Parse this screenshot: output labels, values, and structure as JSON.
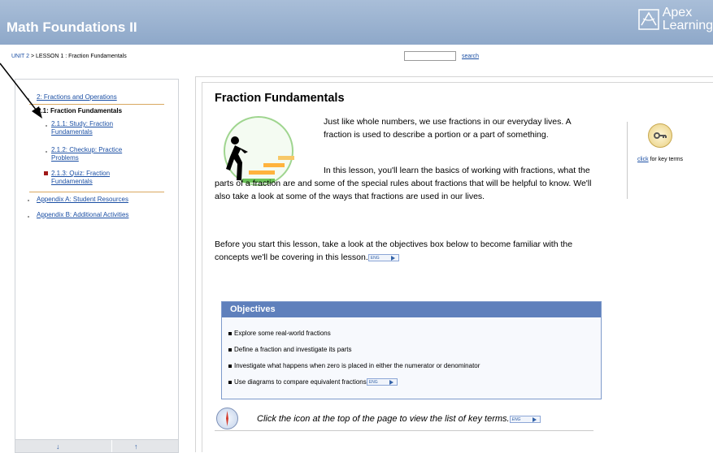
{
  "header": {
    "title": "Math Foundations II",
    "logo_lines": [
      "Apex",
      "Learning"
    ]
  },
  "breadcrumb": {
    "unit": "UNIT 2",
    "sep": " > ",
    "lesson": "LESSON 1 : Fraction Fundamentals"
  },
  "search": {
    "label": "search",
    "value": ""
  },
  "toc": {
    "items": [
      "2: Fractions and Operations",
      "2.1: Fraction Fundamentals",
      "2.1.1: Study: Fraction Fundamentals",
      "2.1.2: Checkup: Practice Problems",
      "2.1.3: Quiz: Fraction Fundamentals",
      "Appendix A: Student Resources",
      "Appendix B: Additional Activities"
    ]
  },
  "content": {
    "title": "Fraction Fundamentals",
    "p1": "Just like whole numbers, we use fractions in our everyday lives. A fraction is used to describe a portion or a part of something.",
    "p2": "In this lesson, you'll learn the basics of working with fractions, what the parts of a fraction are and some of the special rules about fractions that will be helpful to know. We'll also take a look at some of the ways that fractions are used in our lives.",
    "p3": "Before you start this lesson, take a look at the objectives box below to become familiar with the concepts we'll be covering in this lesson.",
    "eng": "ENG"
  },
  "key_terms": {
    "link": "click",
    "text": " for key terms"
  },
  "objectives": {
    "heading": "Objectives",
    "items": [
      "Explore some real-world fractions",
      "Define a fraction and investigate its parts",
      "Investigate what happens when zero is placed in either the numerator or denominator",
      "Use diagrams to compare equivalent fractions"
    ]
  },
  "hint": "Click the icon at the top of the page to view the list of key terms."
}
